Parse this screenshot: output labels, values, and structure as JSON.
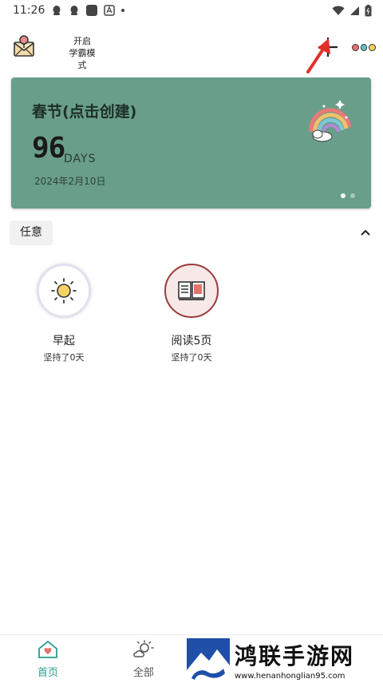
{
  "status_bar": {
    "time": "11:26"
  },
  "header": {
    "mode_label_line1": "开启",
    "mode_label_line2": "学霸模式"
  },
  "card": {
    "title": "春节(点击创建)",
    "days_number": "96",
    "days_unit": "DAYS",
    "date": "2024年2月10日",
    "color": "#699f8a"
  },
  "category": {
    "label": "任意"
  },
  "habits": [
    {
      "name": "早起",
      "streak": "坚持了0天"
    },
    {
      "name": "阅读5页",
      "streak": "坚持了0天"
    }
  ],
  "bottom_nav": {
    "home_label": "首页",
    "all_label": "全部",
    "accent": "#2a9d8f"
  },
  "watermark": {
    "title": "鸿联手游网",
    "subtitle": "www.henanhonglian95.com"
  }
}
